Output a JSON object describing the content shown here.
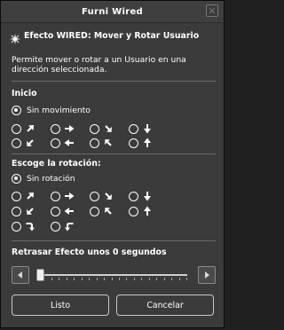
{
  "window": {
    "title": "Furni Wired",
    "close_symbol": "✕"
  },
  "header": {
    "effect_title": "Efecto WIRED: Mover y Rotar Usuario",
    "description": "Permite mover o rotar a un Usuario en una dirección seleccionada.",
    "icon": "sparkle-icon"
  },
  "start": {
    "label": "Inicio",
    "no_movement_label": "Sin movimiento",
    "selected": "none",
    "arrows_row1": [
      "arrow-up-right-icon",
      "arrow-right-icon",
      "arrow-down-right-icon",
      "arrow-down-icon"
    ],
    "arrows_row2": [
      "arrow-down-left-icon",
      "arrow-left-icon",
      "arrow-up-left-icon",
      "arrow-up-icon"
    ]
  },
  "rotation": {
    "label": "Escoge la rotación:",
    "no_rotation_label": "Sin rotación",
    "selected": "none",
    "arrows_row1": [
      "arrow-up-right-icon",
      "arrow-right-icon",
      "arrow-down-right-icon",
      "arrow-down-icon"
    ],
    "arrows_row2": [
      "arrow-down-left-icon",
      "arrow-left-icon",
      "arrow-up-left-icon",
      "arrow-up-icon"
    ],
    "arrows_row3": [
      "rotate-clockwise-icon",
      "rotate-counterclockwise-icon"
    ]
  },
  "delay": {
    "label": "Retrasar Efecto unos 0 segundos",
    "value": 0
  },
  "buttons": {
    "ok": "Listo",
    "cancel": "Cancelar"
  },
  "colors": {
    "panel": "#3b3b3b",
    "text": "#ffffff"
  }
}
